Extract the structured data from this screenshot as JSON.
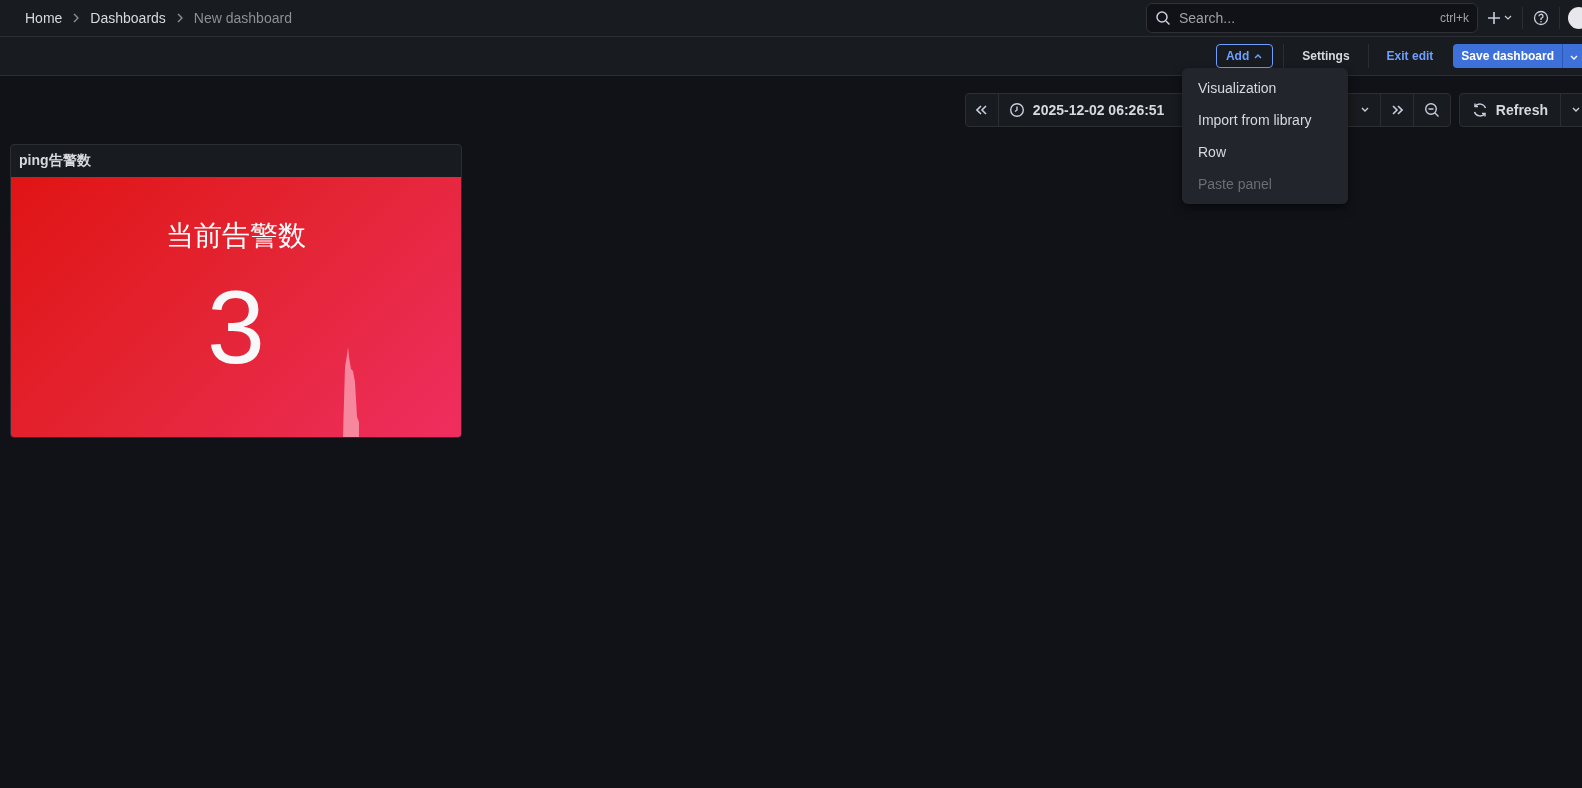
{
  "breadcrumbs": [
    {
      "label": "Home",
      "current": false
    },
    {
      "label": "Dashboards",
      "current": false
    },
    {
      "label": "New dashboard",
      "current": true
    }
  ],
  "search": {
    "placeholder": "Search...",
    "shortcut": "ctrl+k"
  },
  "toolbar": {
    "add": "Add",
    "settings": "Settings",
    "exit_edit": "Exit edit",
    "save": "Save dashboard"
  },
  "time_picker": {
    "range": "2025-12-02 06:26:51",
    "refresh": "Refresh"
  },
  "add_menu": [
    {
      "label": "Visualization",
      "disabled": false
    },
    {
      "label": "Import from library",
      "disabled": false
    },
    {
      "label": "Row",
      "disabled": false
    },
    {
      "label": "Paste panel",
      "disabled": true
    }
  ],
  "panel": {
    "title": "ping告警数",
    "stat_label": "当前告警数",
    "stat_value": "3"
  }
}
